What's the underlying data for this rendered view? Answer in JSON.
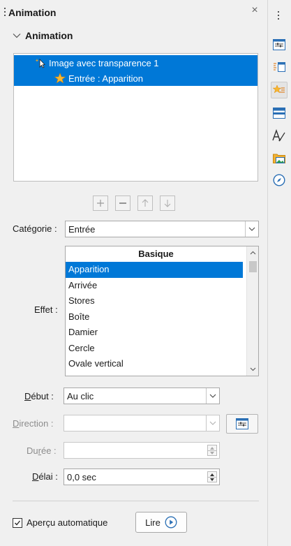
{
  "panel": {
    "title": "Animation",
    "section_title": "Animation"
  },
  "tree": {
    "items": [
      {
        "label": "Image avec transparence 1",
        "icon": "cursor-sparkle-icon"
      },
      {
        "label": "Entrée : Apparition",
        "icon": "star-icon"
      }
    ]
  },
  "toolbar": {
    "add_icon": "plus-icon",
    "remove_icon": "minus-icon",
    "up_icon": "arrow-up-icon",
    "down_icon": "arrow-down-icon"
  },
  "form": {
    "category_label": "Catégorie :",
    "category_value": "Entrée",
    "effect_label": "Effet :",
    "effect_list": {
      "header": "Basique",
      "items": [
        "Apparition",
        "Arrivée",
        "Stores",
        "Boîte",
        "Damier",
        "Cercle",
        "Ovale vertical"
      ],
      "selected": "Apparition"
    },
    "start_label_prefix": "D",
    "start_label_rest": "ébut :",
    "start_value": "Au clic",
    "direction_label_prefix": "D",
    "direction_label_rest": "irection :",
    "direction_value": "",
    "duration_label_prefix": "Du",
    "duration_label_u": "r",
    "duration_label_rest": "ée :",
    "duration_value": "",
    "delay_label_prefix": "D",
    "delay_label_rest": "élai :",
    "delay_value": "0,0 sec"
  },
  "footer": {
    "autopreview_label": "Aperçu automatique",
    "autopreview_checked": true,
    "play_label": "Lire"
  },
  "colors": {
    "selection": "#0078d7",
    "panel_bg": "#f0f0f0"
  }
}
